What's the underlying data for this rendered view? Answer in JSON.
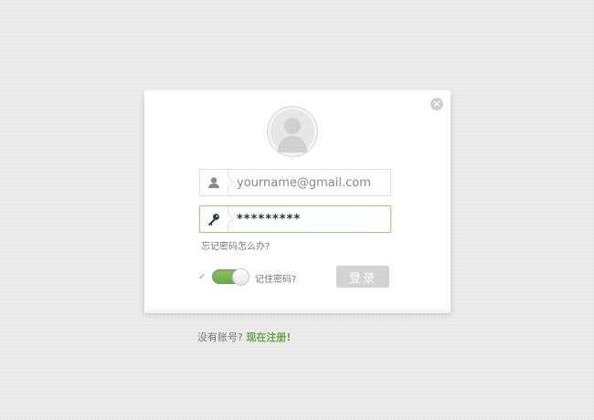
{
  "dialog": {
    "close_label": "×",
    "username": {
      "placeholder": "yourname@gmail.com",
      "value": ""
    },
    "password": {
      "value": "*********"
    },
    "forgot_label": "忘记密码怎么办?",
    "remember": {
      "check_mark": "✓",
      "label": "记住密码?",
      "on": true
    },
    "login_label": "登录"
  },
  "footer": {
    "prompt": "没有账号?",
    "register_link": "现在注册",
    "suffix": "!"
  },
  "colors": {
    "accent": "#6aa447",
    "button_disabled": "#d3d3d3",
    "background": "#e8e8e8"
  },
  "icons": [
    "close-icon",
    "avatar-icon",
    "user-icon",
    "key-icon",
    "check-icon"
  ]
}
